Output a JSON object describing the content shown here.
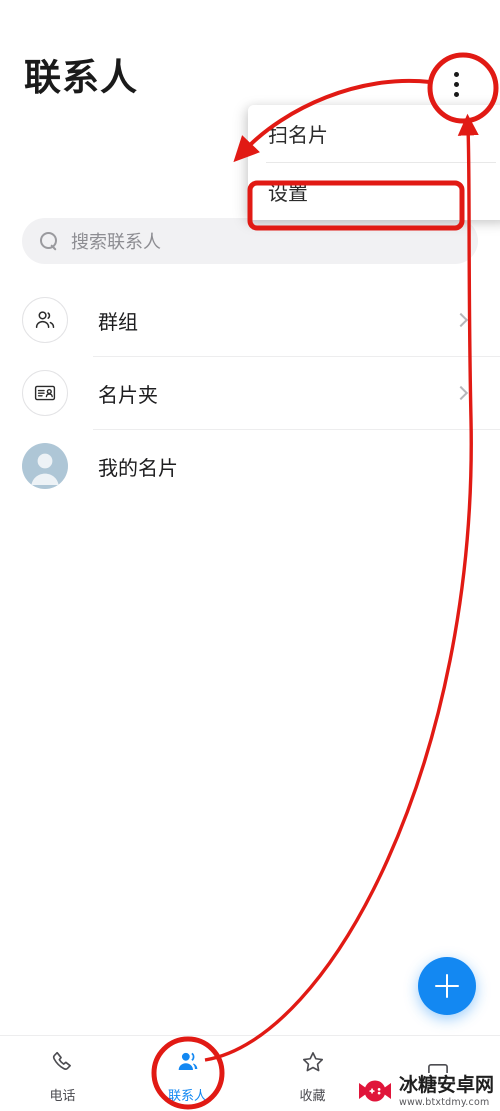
{
  "header": {
    "title": "联系人",
    "overflow_menu_icon": "three-dots-vertical-icon"
  },
  "dropdown": {
    "items": [
      {
        "label": "扫名片",
        "name": "scan-business-card"
      },
      {
        "label": "设置",
        "name": "settings"
      }
    ]
  },
  "search": {
    "placeholder": "搜索联系人",
    "icon": "search-icon"
  },
  "list": {
    "items": [
      {
        "label": "群组",
        "icon": "group-people-icon",
        "chevron": true
      },
      {
        "label": "名片夹",
        "icon": "id-card-icon",
        "chevron": true
      },
      {
        "label": "我的名片",
        "icon": "avatar-icon",
        "chevron": false
      }
    ]
  },
  "fab": {
    "icon": "plus-icon",
    "color": "#1388f2"
  },
  "bottom_nav": {
    "items": [
      {
        "label": "电话",
        "icon": "phone-icon",
        "active": false
      },
      {
        "label": "联系人",
        "icon": "contacts-person-icon",
        "active": true
      },
      {
        "label": "收藏",
        "icon": "star-icon",
        "active": false
      },
      {
        "label": "",
        "icon": "more-icon",
        "active": false
      }
    ]
  },
  "annotations": {
    "color": "#e11a14",
    "highlight_circle_menu_button": "three-dots-vertical-icon",
    "highlight_box_target": "设置",
    "highlight_circle_nav_tab": "联系人"
  },
  "watermark": {
    "title": "冰糖安卓网",
    "url": "www.btxtdmy.com",
    "logo": "candy-gamepad-logo"
  }
}
